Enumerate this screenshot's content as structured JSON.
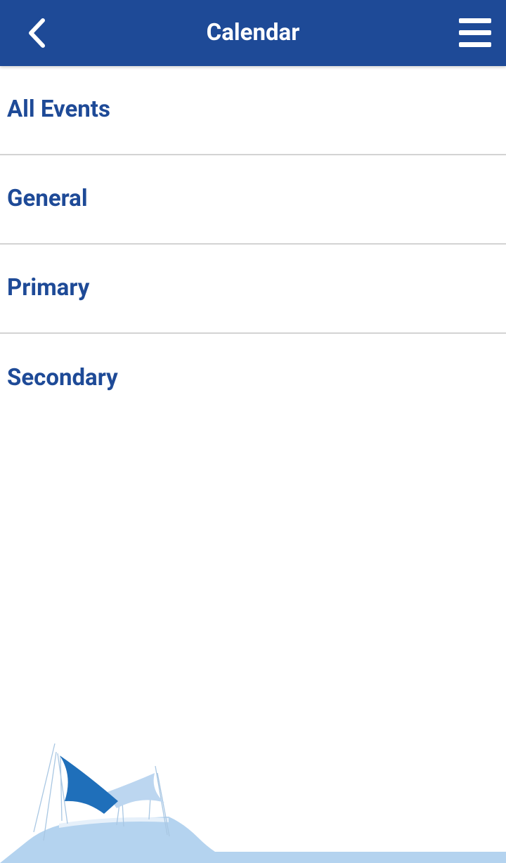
{
  "header": {
    "title": "Calendar",
    "back_icon": "chevron-left-icon",
    "menu_icon": "hamburger-menu-icon",
    "background_color": "#1e4a97",
    "text_color": "#ffffff"
  },
  "list": {
    "items": [
      {
        "label": "All Events"
      },
      {
        "label": "General"
      },
      {
        "label": "Primary"
      },
      {
        "label": "Secondary"
      }
    ],
    "text_color": "#1e4a97",
    "divider_color": "#d3d3d3"
  },
  "footer": {
    "illustration": "shade-sail-tent-illustration",
    "colors": {
      "dark_blue": "#1f6fba",
      "light_blue": "#b4d3ef"
    }
  }
}
